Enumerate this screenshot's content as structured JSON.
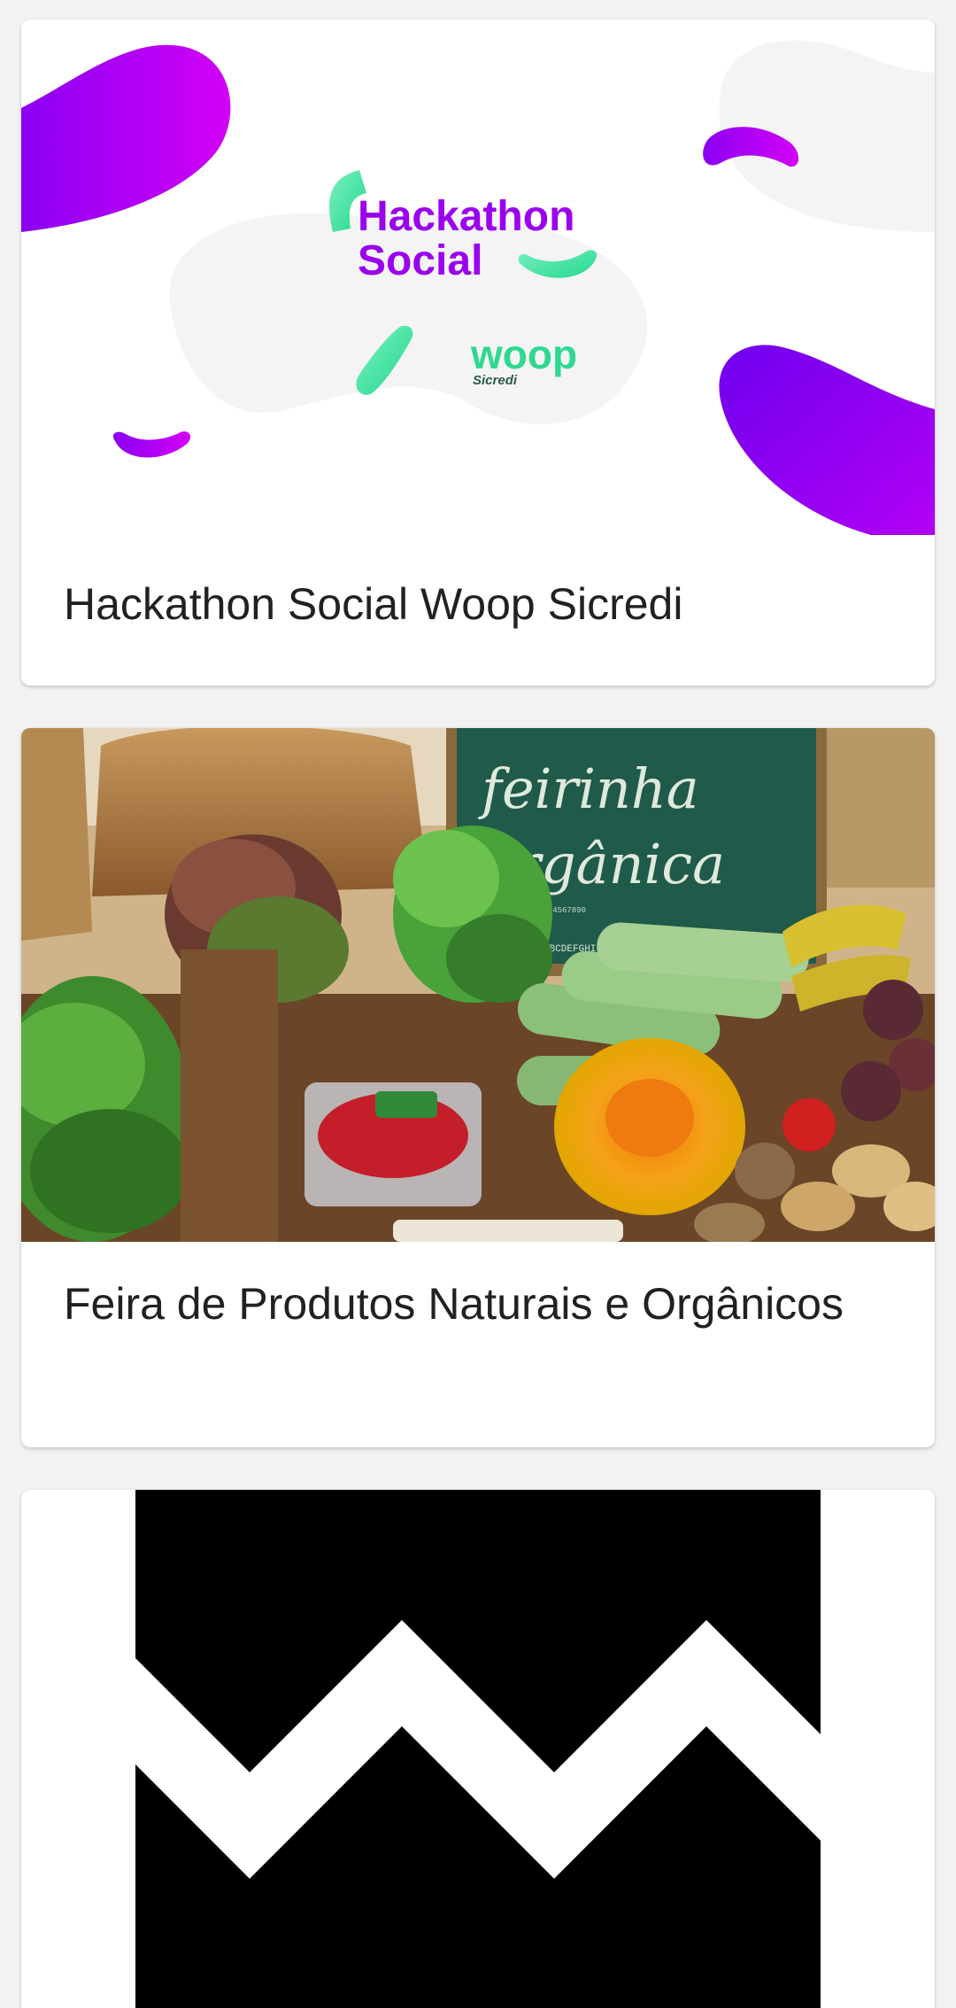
{
  "events": [
    {
      "title": "Hackathon Social Woop Sicredi",
      "image": {
        "logo_line1": "Hackathon",
        "logo_line2": "Social",
        "brand": "woop",
        "brand_sub": "Sicredi"
      }
    },
    {
      "title": "Feira de Produtos Naturais e Orgânicos",
      "image": {
        "chalk_line1": "feirinha",
        "chalk_line2": "orgânica",
        "alphabet": "ABCDEFGHIJKLMNOPQRSTU",
        "digits": "1234567890"
      }
    },
    {
      "title": "",
      "image": {}
    }
  ],
  "colors": {
    "purple": "#8b00f2",
    "magenta": "#c600f5",
    "mint": "#3ee0a0",
    "chalkboard": "#1f5a4a",
    "page_bg": "#f2f2f2",
    "card_bg": "#ffffff",
    "title_text": "#212121"
  }
}
